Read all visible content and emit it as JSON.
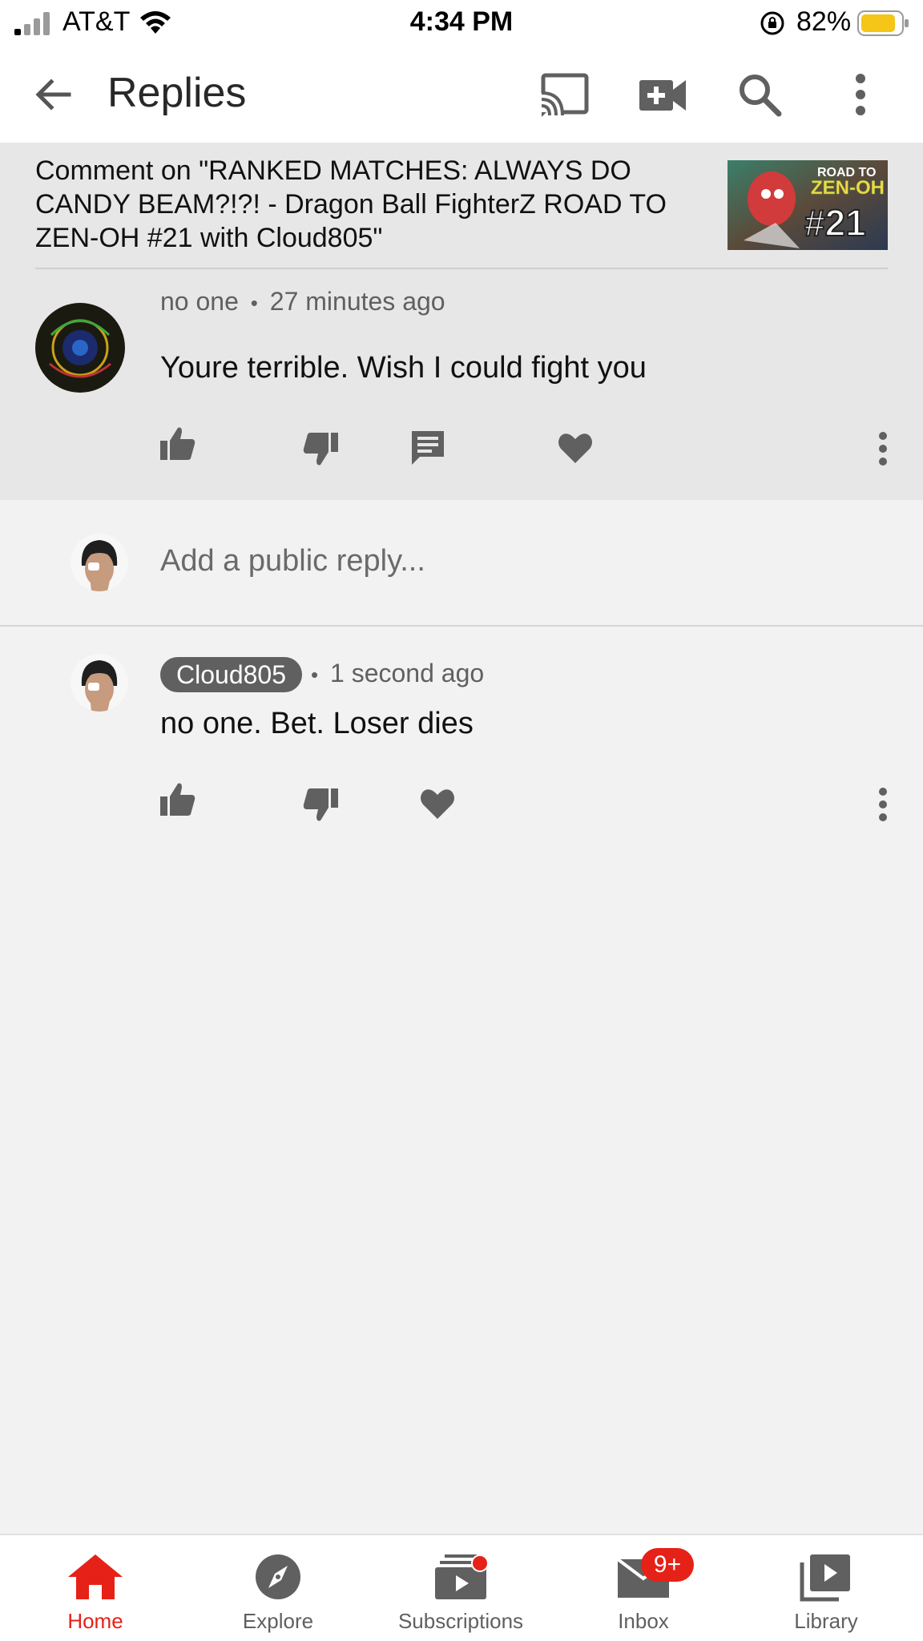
{
  "status_bar": {
    "carrier": "AT&T",
    "time": "4:34 PM",
    "battery_percent": "82%",
    "battery_color": "#f5c518"
  },
  "app_bar": {
    "title": "Replies",
    "icons": [
      "back-arrow-icon",
      "cast-icon",
      "video-camera-add-icon",
      "search-icon",
      "more-vert-icon"
    ]
  },
  "video_header": {
    "text": "Comment on \"RANKED MATCHES: ALWAYS DO CANDY BEAM?!?! - Dragon Ball FighterZ ROAD TO ZEN-OH #21 with Cloud805\"",
    "thumbnail": {
      "line1": "ROAD TO",
      "line2": "ZEN-OH",
      "number": "#21"
    }
  },
  "parent_comment": {
    "author": "no one",
    "separator": "•",
    "time": "27 minutes ago",
    "text": "Youre terrible. Wish I could fight you"
  },
  "reply_input": {
    "placeholder": "Add a public reply..."
  },
  "reply": {
    "author": "Cloud805",
    "separator": "•",
    "time": "1 second ago",
    "text": "no one. Bet. Loser dies"
  },
  "bottom_nav": {
    "items": [
      {
        "label": "Home",
        "icon": "home-icon",
        "active": true
      },
      {
        "label": "Explore",
        "icon": "compass-icon",
        "active": false
      },
      {
        "label": "Subscriptions",
        "icon": "subscriptions-icon",
        "active": false
      },
      {
        "label": "Inbox",
        "icon": "inbox-icon",
        "active": false
      },
      {
        "label": "Library",
        "icon": "library-icon",
        "active": false
      }
    ],
    "inbox_badge": "9+",
    "accent_color": "#e62117"
  }
}
